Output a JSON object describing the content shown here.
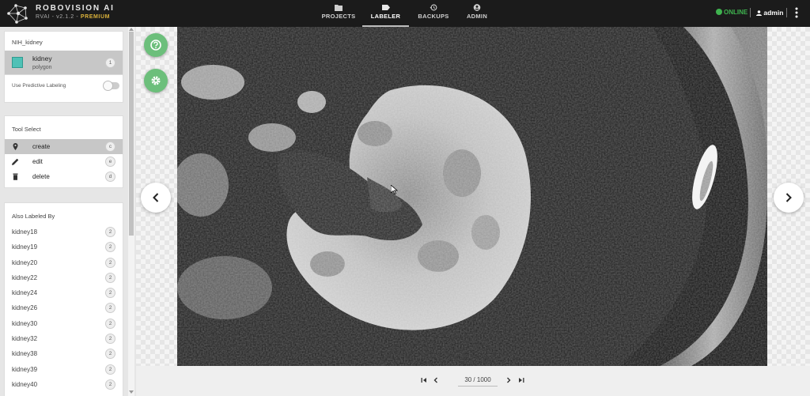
{
  "app": {
    "brand": "ROBOVISION AI",
    "version": "RVAI - v2.1.2 -",
    "edition": "PREMIUM",
    "nav": [
      {
        "label": "PROJECTS",
        "icon": "folder-icon"
      },
      {
        "label": "LABELER",
        "icon": "label-tag-icon"
      },
      {
        "label": "BACKUPS",
        "icon": "history-icon"
      },
      {
        "label": "ADMIN",
        "icon": "account-icon"
      }
    ],
    "status": "ONLINE",
    "user": "admin"
  },
  "sidebar": {
    "project_name": "NIH_kidney",
    "label": {
      "name": "kidney",
      "type": "polygon",
      "count": "1",
      "color": "#4fc1b6"
    },
    "predictive_label": "Use Predictive Labeling",
    "tool_title": "Tool Select",
    "tools": [
      {
        "name": "create",
        "key": "c",
        "icon": "pin-icon"
      },
      {
        "name": "edit",
        "key": "e",
        "icon": "pencil-icon"
      },
      {
        "name": "delete",
        "key": "d",
        "icon": "trash-icon"
      }
    ],
    "also_title": "Also Labeled By",
    "also_labeled": [
      {
        "name": "kidney18",
        "count": "2"
      },
      {
        "name": "kidney19",
        "count": "2"
      },
      {
        "name": "kidney20",
        "count": "2"
      },
      {
        "name": "kidney22",
        "count": "2"
      },
      {
        "name": "kidney24",
        "count": "2"
      },
      {
        "name": "kidney26",
        "count": "2"
      },
      {
        "name": "kidney30",
        "count": "2"
      },
      {
        "name": "kidney32",
        "count": "2"
      },
      {
        "name": "kidney38",
        "count": "2"
      },
      {
        "name": "kidney39",
        "count": "2"
      },
      {
        "name": "kidney40",
        "count": "2"
      }
    ]
  },
  "pager": {
    "position": "30 / 1000"
  }
}
